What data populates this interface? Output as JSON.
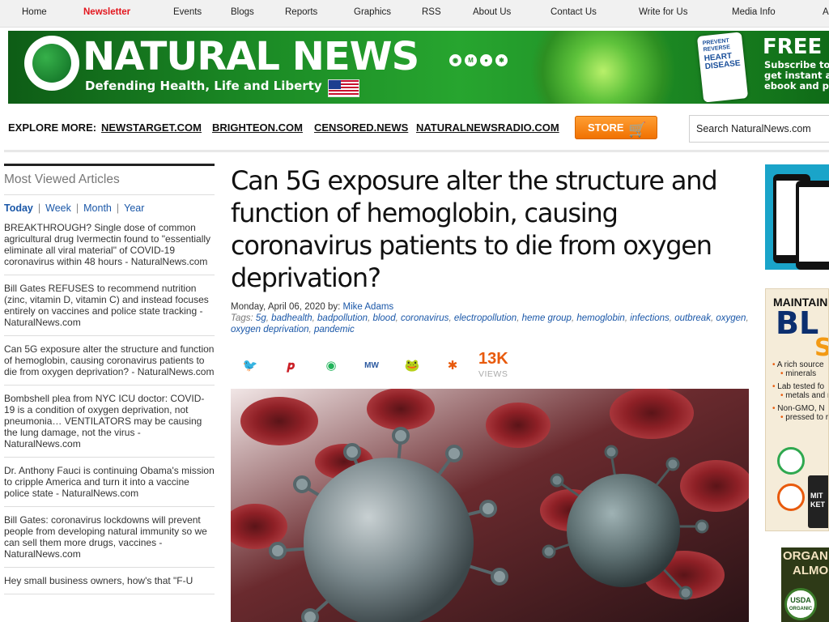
{
  "topnav": {
    "items": [
      "Home",
      "Newsletter",
      "Events",
      "Blogs",
      "Reports",
      "Graphics",
      "RSS",
      "About Us",
      "Contact Us",
      "Write for Us",
      "Media Info",
      "A"
    ]
  },
  "banner": {
    "brand": "NATURAL NEWS",
    "tagline": "Defending Health, Life and Liberty",
    "social_icons": [
      "brighteon-icon",
      "mewe-icon",
      "gab-icon",
      "minds-icon"
    ],
    "book_text": [
      "PREVENT",
      "REVERSE",
      "HEART",
      "DISEASE"
    ],
    "free_title": "FREE",
    "free_sub": [
      "Subscribe to o",
      "get instant acc",
      "ebook and pdf"
    ],
    "brand_color": "#1f8f26"
  },
  "explore": {
    "label": "EXPLORE MORE:",
    "links": [
      "NEWSTARGET.COM",
      "BRIGHTEON.COM",
      "CENSORED.NEWS",
      "NATURALNEWSRADIO.COM"
    ],
    "store_label": "STORE",
    "store_icon": "cart-icon",
    "search_value": "Search NaturalNews.com"
  },
  "sidebar": {
    "title": "Most Viewed Articles",
    "tabs": [
      "Today",
      "Week",
      "Month",
      "Year"
    ],
    "active_tab": "Today",
    "articles": [
      "BREAKTHROUGH? Single dose of common agricultural drug Ivermectin found to \"essentially eliminate all viral material\" of COVID-19 coronavirus within 48 hours - NaturalNews.com",
      "Bill Gates REFUSES to recommend nutrition (zinc, vitamin D, vitamin C) and instead focuses entirely on vaccines and police state tracking - NaturalNews.com",
      "Can 5G exposure alter the structure and function of hemoglobin, causing coronavirus patients to die from oxygen deprivation? - NaturalNews.com",
      "Bombshell plea from NYC ICU doctor: COVID-19 is a condition of oxygen deprivation, not pneumonia… VENTILATORS may be causing the lung damage, not the virus - NaturalNews.com",
      "Dr. Anthony Fauci is continuing Obama's mission to cripple America and turn it into a vaccine police state - NaturalNews.com",
      "Bill Gates: coronavirus lockdowns will prevent people from developing natural immunity so we can sell them more drugs, vaccines - NaturalNews.com",
      "Hey small business owners, how's that \"F-U"
    ]
  },
  "article": {
    "headline": "Can 5G exposure alter the structure and function of hemoglobin, causing coronavirus patients to die from oxygen deprivation?",
    "date_by": "Monday, April 06, 2020 by:",
    "author": "Mike Adams",
    "tags_label": "Tags:",
    "tags": [
      "5g",
      "badhealth",
      "badpollution",
      "blood",
      "coronavirus",
      "electropollution",
      "heme group",
      "hemoglobin",
      "infections",
      "outbreak",
      "oxygen",
      "oxygen deprivation",
      "pandemic"
    ],
    "share_icons": [
      "twitter-icon",
      "pinterest-icon",
      "brighteon-icon",
      "mewe-icon",
      "gab-icon",
      "minds-icon"
    ],
    "share_glyphs": [
      "🐦",
      "𝒑",
      "◉",
      "MW",
      "🐸",
      "✱"
    ],
    "views_count": "13K",
    "views_label": "VIEWS",
    "accent_color": "#e85a0c"
  },
  "ads": {
    "ad2": {
      "line1": "MAINTAIN A",
      "line2": "BL",
      "line3": "S",
      "bullets": [
        "A rich source",
        "minerals",
        "Lab tested fo",
        "metals and m",
        "Non-GMO, N",
        "pressed to re"
      ],
      "seal_text": "MIT",
      "seal_sub": "KET"
    },
    "ad3": {
      "line1": "ORGAN",
      "line2": "ALMO",
      "seal1": "USDA",
      "seal2": "ORGANIC"
    }
  }
}
